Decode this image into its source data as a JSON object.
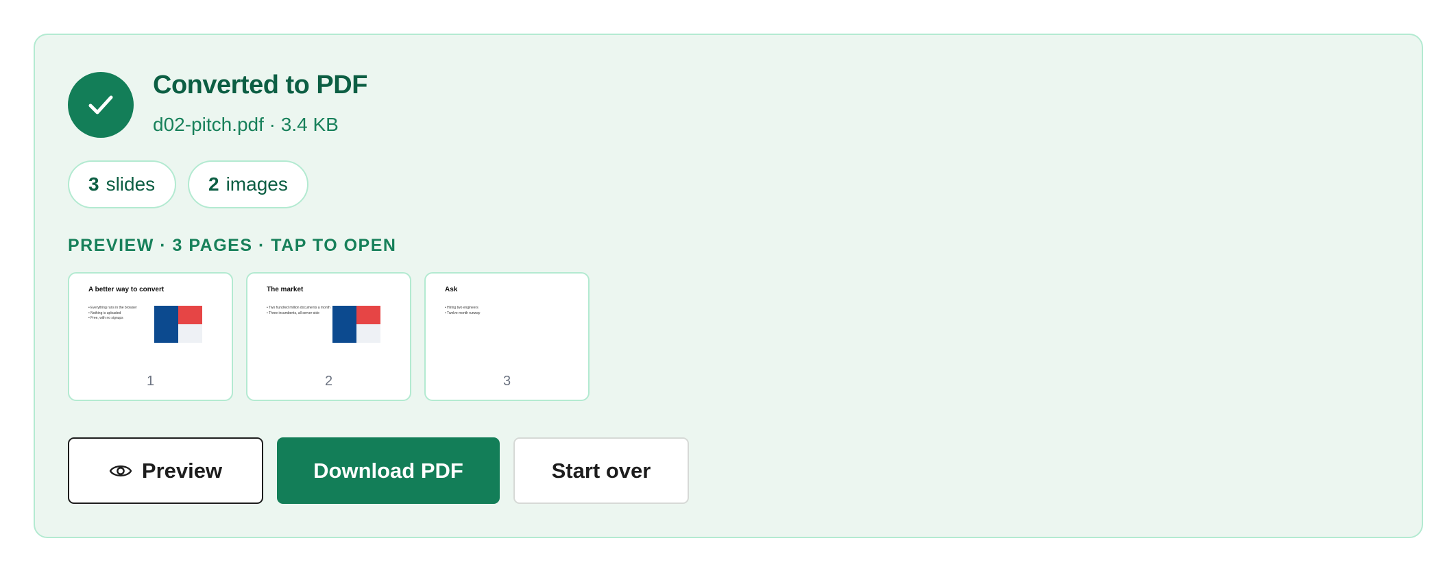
{
  "result": {
    "title": "Converted to PDF",
    "file_info": "d02-pitch.pdf · 3.4 KB",
    "success_color": "#137e58",
    "icon": "check-icon"
  },
  "stats": [
    {
      "count": "3",
      "label": "slides"
    },
    {
      "count": "2",
      "label": "images"
    }
  ],
  "preview_label": "PREVIEW · 3 PAGES · TAP TO OPEN",
  "thumbnails": [
    {
      "page": "1",
      "title": "A better way to convert",
      "bullets": [
        "• Everything runs in the browser",
        "• Nothing is uploaded",
        "• Free, with no signups"
      ],
      "has_chart": true
    },
    {
      "page": "2",
      "title": "The market",
      "bullets": [
        "• Two hundred million documents a month",
        "• Three incumbents, all server-side"
      ],
      "has_chart": true
    },
    {
      "page": "3",
      "title": "Ask",
      "bullets": [
        "• Hiring two engineers",
        "• Twelve month runway"
      ],
      "has_chart": false
    }
  ],
  "buttons": {
    "preview": "Preview",
    "preview_icon": "eye-icon",
    "download": "Download PDF",
    "start_over": "Start over"
  },
  "colors": {
    "card_bg": "#ecf6f0",
    "card_border": "#b3ead1",
    "heading": "#0c5e43",
    "chart_blue": "#0c4a8f",
    "chart_red": "#e64545"
  }
}
